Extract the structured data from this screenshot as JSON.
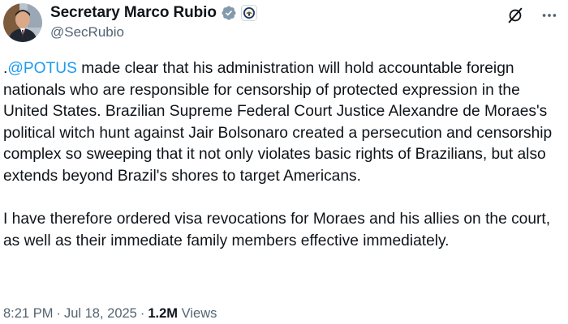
{
  "account": {
    "display_name": "Secretary Marco Rubio",
    "handle": "@SecRubio"
  },
  "tweet": {
    "lead": ".",
    "mention": "@POTUS",
    "paragraph1_rest": " made clear that his administration will hold accountable foreign nationals who are responsible for censorship of protected expression in the United States. Brazilian Supreme Federal Court Justice Alexandre de Moraes's political witch hunt against Jair Bolsonaro created a persecution and censorship complex so sweeping that it not only violates basic rights of Brazilians, but also extends beyond Brazil's shores to target Americans.",
    "paragraph2": "I have therefore ordered visa revocations for Moraes and his allies on the court, as well as their immediate family members effective immediately."
  },
  "meta": {
    "time": "8:21 PM",
    "separator": "·",
    "date": "Jul 18, 2025",
    "views_count": "1.2M",
    "views_label": "Views"
  },
  "colors": {
    "accent": "#1d9bf0",
    "verified_gray": "#829aab",
    "text": "#0f1419",
    "secondary": "#536471"
  },
  "icons": {
    "verified": "gray-verified-badge-icon",
    "affiliation": "state-department-seal-icon",
    "grok": "grok-icon",
    "more": "more-icon"
  }
}
